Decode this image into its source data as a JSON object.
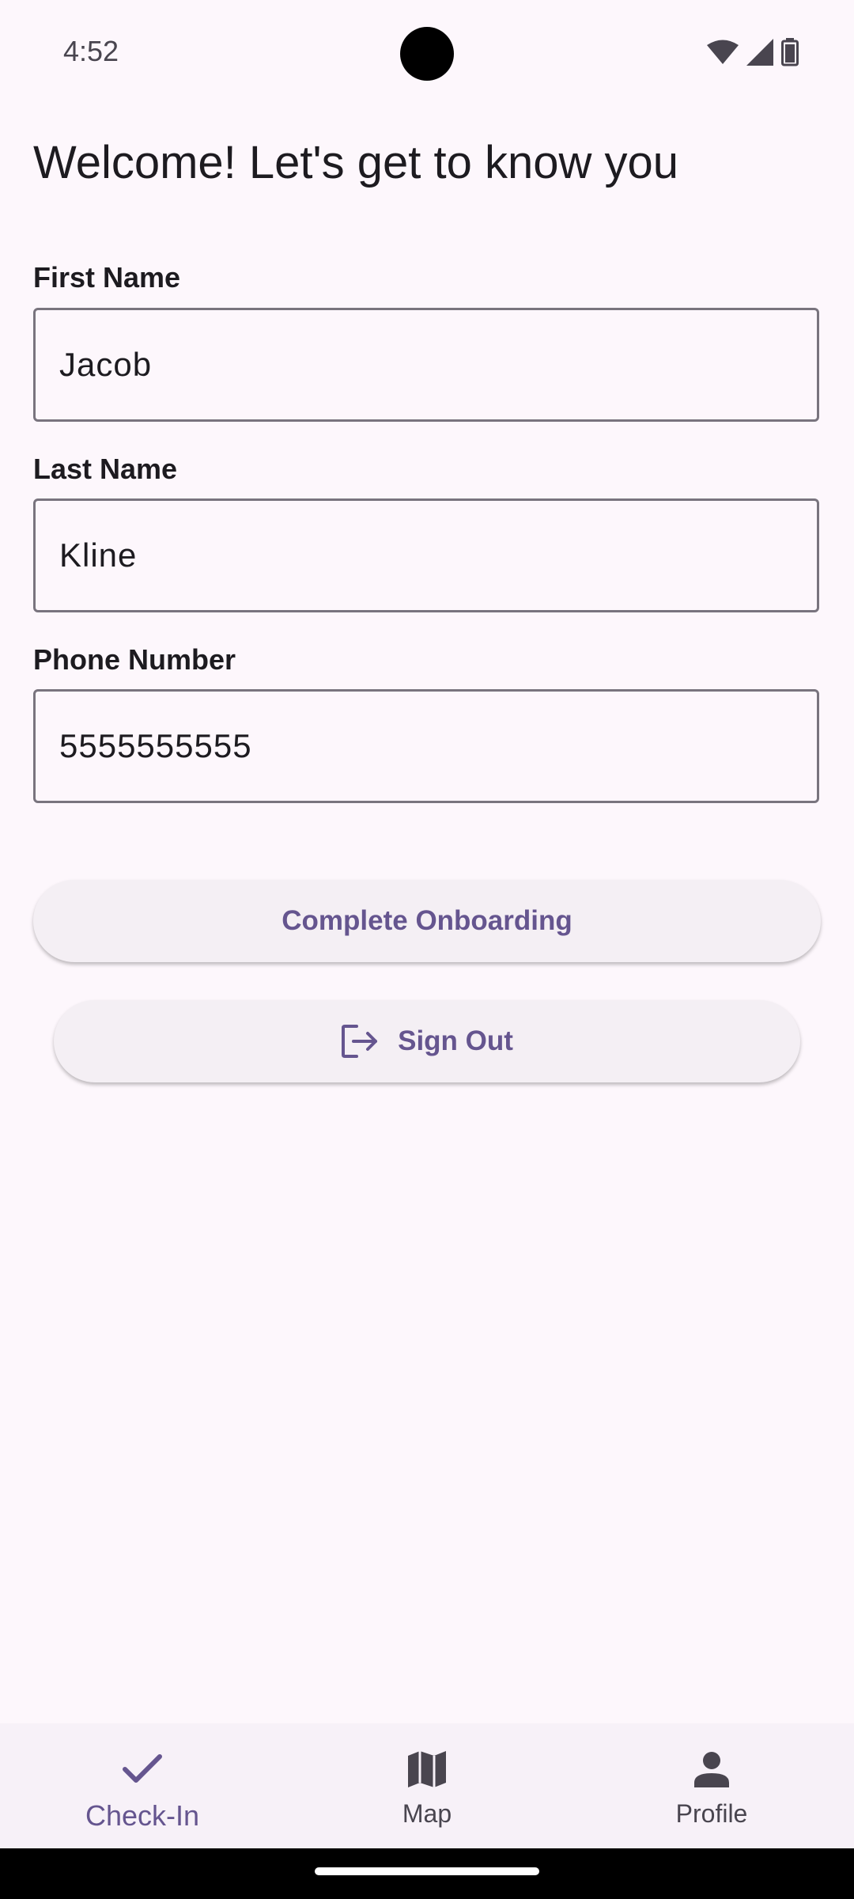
{
  "status_bar": {
    "time": "4:52",
    "icons": [
      "wifi-icon",
      "signal-icon",
      "battery-icon"
    ]
  },
  "page": {
    "title": "Welcome! Let's get to know you"
  },
  "form": {
    "first_name": {
      "label": "First Name",
      "value": "Jacob"
    },
    "last_name": {
      "label": "Last Name",
      "value": "Kline"
    },
    "phone": {
      "label": "Phone Number",
      "value": "5555555555"
    }
  },
  "actions": {
    "complete_label": "Complete Onboarding",
    "sign_out_label": "Sign Out"
  },
  "bottom_nav": {
    "items": [
      {
        "label": "Check-In",
        "icon": "check-icon",
        "active": true
      },
      {
        "label": "Map",
        "icon": "map-icon",
        "active": false
      },
      {
        "label": "Profile",
        "icon": "person-icon",
        "active": false
      }
    ]
  },
  "colors": {
    "background": "#fdf7fc",
    "accent": "#65558f",
    "button_bg": "#f4eff4",
    "outline": "#79747e"
  }
}
